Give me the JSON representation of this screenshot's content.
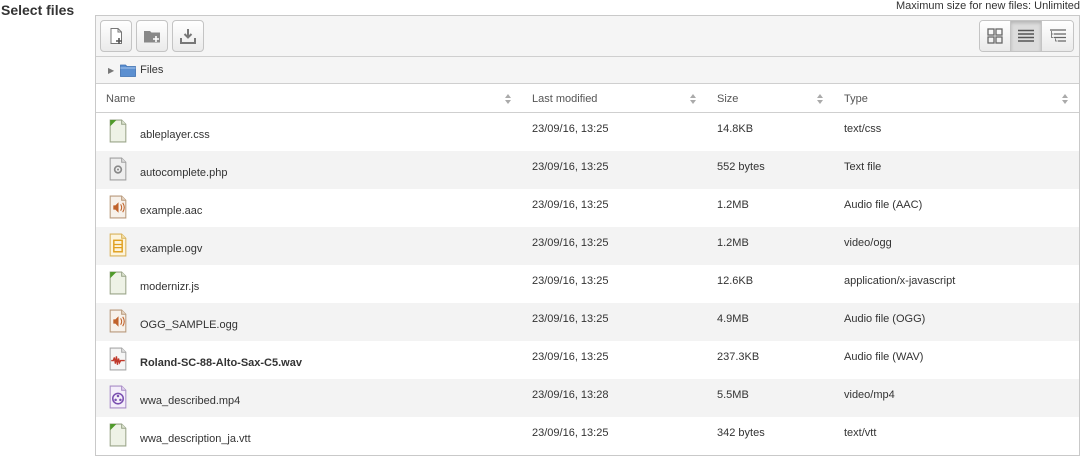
{
  "page_label": "Select files",
  "max_size_text": "Maximum size for new files: Unlimited",
  "toolbar": {
    "buttons": [
      {
        "name": "create-file-button",
        "icon": "new-file-icon"
      },
      {
        "name": "create-folder-button",
        "icon": "new-folder-icon"
      },
      {
        "name": "download-button",
        "icon": "download-icon"
      }
    ],
    "views": [
      {
        "name": "view-icons-button",
        "icon": "grid-view-icon",
        "active": false
      },
      {
        "name": "view-details-button",
        "icon": "list-view-icon",
        "active": true
      },
      {
        "name": "view-tree-button",
        "icon": "tree-view-icon",
        "active": false
      }
    ]
  },
  "path": {
    "folder": "Files"
  },
  "columns": {
    "name": "Name",
    "modified": "Last modified",
    "size": "Size",
    "type": "Type"
  },
  "files": [
    {
      "name": "ableplayer.css",
      "modified": "23/09/16, 13:25",
      "size": "14.8KB",
      "type": "text/css",
      "icon": "text-file-icon",
      "bold": false
    },
    {
      "name": "autocomplete.php",
      "modified": "23/09/16, 13:25",
      "size": "552 bytes",
      "type": "Text file",
      "icon": "code-file-icon",
      "bold": false
    },
    {
      "name": "example.aac",
      "modified": "23/09/16, 13:25",
      "size": "1.2MB",
      "type": "Audio file (AAC)",
      "icon": "audio-file-icon",
      "bold": false
    },
    {
      "name": "example.ogv",
      "modified": "23/09/16, 13:25",
      "size": "1.2MB",
      "type": "video/ogg",
      "icon": "video-ogg-icon",
      "bold": false
    },
    {
      "name": "modernizr.js",
      "modified": "23/09/16, 13:25",
      "size": "12.6KB",
      "type": "application/x-javascript",
      "icon": "text-file-icon",
      "bold": false
    },
    {
      "name": "OGG_SAMPLE.ogg",
      "modified": "23/09/16, 13:25",
      "size": "4.9MB",
      "type": "Audio file (OGG)",
      "icon": "audio-file-icon",
      "bold": false
    },
    {
      "name": "Roland-SC-88-Alto-Sax-C5.wav",
      "modified": "23/09/16, 13:25",
      "size": "237.3KB",
      "type": "Audio file (WAV)",
      "icon": "wav-file-icon",
      "bold": true
    },
    {
      "name": "wwa_described.mp4",
      "modified": "23/09/16, 13:28",
      "size": "5.5MB",
      "type": "video/mp4",
      "icon": "video-mp4-icon",
      "bold": false
    },
    {
      "name": "wwa_description_ja.vtt",
      "modified": "23/09/16, 13:25",
      "size": "342 bytes",
      "type": "text/vtt",
      "icon": "text-file-icon",
      "bold": false
    }
  ]
}
